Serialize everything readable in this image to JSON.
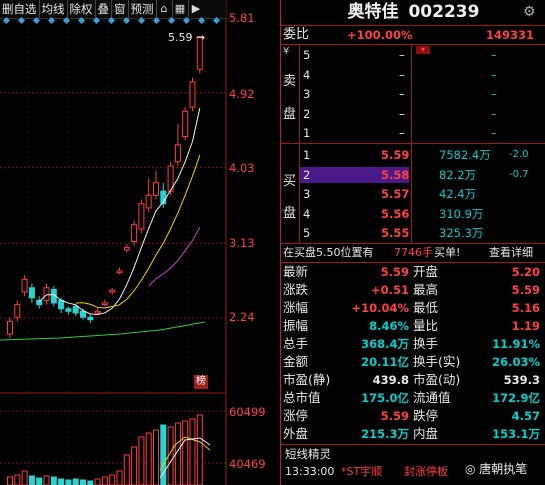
{
  "toolbar": {
    "items": [
      "删自选",
      "均线",
      "除权",
      "叠",
      "窗",
      "预测"
    ],
    "icons": [
      "lock-icon",
      "grid-icon",
      "next-icon"
    ]
  },
  "price_axis": [
    "5.81",
    "4.92",
    "4.03",
    "3.13",
    "2.24"
  ],
  "volume_axis": [
    "60499",
    "40469"
  ],
  "chart_labels": {
    "high_marker": "5.59",
    "rank_tag": "榜"
  },
  "chart_data": {
    "type": "candlestick",
    "ylim": [
      1.8,
      5.81
    ],
    "candles": [
      {
        "o": 2.05,
        "c": 2.2,
        "h": 2.25,
        "l": 2.0
      },
      {
        "o": 2.25,
        "c": 2.4,
        "h": 2.45,
        "l": 2.2
      },
      {
        "o": 2.55,
        "c": 2.7,
        "h": 2.75,
        "l": 2.5
      },
      {
        "o": 2.6,
        "c": 2.48,
        "h": 2.65,
        "l": 2.42
      },
      {
        "o": 2.45,
        "c": 2.4,
        "h": 2.5,
        "l": 2.35
      },
      {
        "o": 2.45,
        "c": 2.6,
        "h": 2.65,
        "l": 2.4
      },
      {
        "o": 2.58,
        "c": 2.42,
        "h": 2.62,
        "l": 2.38
      },
      {
        "o": 2.45,
        "c": 2.35,
        "h": 2.48,
        "l": 2.3
      },
      {
        "o": 2.35,
        "c": 2.32,
        "h": 2.38,
        "l": 2.28
      },
      {
        "o": 2.38,
        "c": 2.3,
        "h": 2.4,
        "l": 2.26
      },
      {
        "o": 2.32,
        "c": 2.25,
        "h": 2.35,
        "l": 2.22
      },
      {
        "o": 2.25,
        "c": 2.22,
        "h": 2.28,
        "l": 2.18
      },
      {
        "o": 2.3,
        "c": 2.32,
        "h": 2.36,
        "l": 2.28
      },
      {
        "o": 2.4,
        "c": 2.42,
        "h": 2.46,
        "l": 2.38
      },
      {
        "o": 2.55,
        "c": 2.57,
        "h": 2.6,
        "l": 2.52
      },
      {
        "o": 2.78,
        "c": 2.8,
        "h": 2.84,
        "l": 2.76
      },
      {
        "o": 3.05,
        "c": 3.08,
        "h": 3.12,
        "l": 3.02
      },
      {
        "o": 3.15,
        "c": 3.35,
        "h": 3.4,
        "l": 3.1
      },
      {
        "o": 3.3,
        "c": 3.6,
        "h": 3.65,
        "l": 3.25
      },
      {
        "o": 3.55,
        "c": 3.7,
        "h": 3.9,
        "l": 3.5
      },
      {
        "o": 3.7,
        "c": 3.85,
        "h": 4.0,
        "l": 3.65
      },
      {
        "o": 3.75,
        "c": 3.6,
        "h": 3.85,
        "l": 3.55
      },
      {
        "o": 3.75,
        "c": 4.05,
        "h": 4.1,
        "l": 3.7
      },
      {
        "o": 4.1,
        "c": 4.3,
        "h": 4.55,
        "l": 4.05
      },
      {
        "o": 4.4,
        "c": 4.7,
        "h": 4.75,
        "l": 4.35
      },
      {
        "o": 4.75,
        "c": 5.05,
        "h": 5.1,
        "l": 4.7
      },
      {
        "o": 5.2,
        "c": 5.59,
        "h": 5.59,
        "l": 5.15
      }
    ]
  },
  "panel": {
    "title": "奥特佳",
    "code": "002239",
    "weibi_label": "委比",
    "weibi_value": "+100.00%",
    "weicha_value": "149331",
    "sell_label": [
      "卖",
      "盘"
    ],
    "buy_label": [
      "买",
      "盘"
    ],
    "sell_levels": [
      {
        "n": "5",
        "p": "–",
        "v": "–"
      },
      {
        "n": "4",
        "p": "–",
        "v": "–"
      },
      {
        "n": "3",
        "p": "–",
        "v": "–"
      },
      {
        "n": "2",
        "p": "–",
        "v": "–"
      },
      {
        "n": "1",
        "p": "–",
        "v": "–"
      }
    ],
    "buy_levels": [
      {
        "n": "1",
        "p": "5.59",
        "v": "7582.4万",
        "chg": "-2.0"
      },
      {
        "n": "2",
        "p": "5.58",
        "v": "82.2万",
        "chg": "-0.7"
      },
      {
        "n": "3",
        "p": "5.57",
        "v": "42.4万",
        "chg": ""
      },
      {
        "n": "4",
        "p": "5.56",
        "v": "310.9万",
        "chg": ""
      },
      {
        "n": "5",
        "p": "5.55",
        "v": "325.3万",
        "chg": ""
      }
    ],
    "notice": "在买盘5.50位置有",
    "notice_qty": "7746手",
    "notice_tail": "买单!",
    "notice_link": "查看详细",
    "stats": [
      [
        "最新",
        "5.59",
        "开盘",
        "5.20"
      ],
      [
        "涨跌",
        "+0.51",
        "最高",
        "5.59"
      ],
      [
        "涨幅",
        "+10.04%",
        "最低",
        "5.16"
      ],
      [
        "振幅",
        "8.46%",
        "量比",
        "1.19"
      ],
      [
        "总手",
        "368.4万",
        "换手",
        "11.91%"
      ],
      [
        "金额",
        "20.11亿",
        "换手(实)",
        "26.03%"
      ],
      [
        "市盈(静)",
        "439.8",
        "市盈(动)",
        "539.3"
      ],
      [
        "总市值",
        "175.0亿",
        "流通值",
        "172.9亿"
      ],
      [
        "涨停",
        "5.59",
        "跌停",
        "4.57"
      ],
      [
        "外盘",
        "215.3万",
        "内盘",
        "153.1万"
      ]
    ],
    "elf_title": "短线精灵",
    "elf_time": "13:33:00",
    "elf_name": "*ST宇顺",
    "elf_event": "封涨停板",
    "watermark": "唐朝执笔"
  }
}
